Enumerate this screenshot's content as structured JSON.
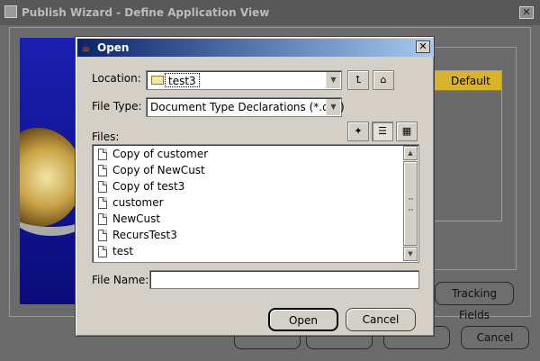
{
  "outer_window": {
    "title": "Publish Wizard - Define Application View",
    "close_glyph": "✕",
    "table_header": "Default",
    "tracking_fields_label": "Tracking Fields",
    "cancel_label": "Cancel"
  },
  "dialog": {
    "title": "Open",
    "close_glyph": "✕",
    "location_label": "Location:",
    "location_value": "test3",
    "file_type_label": "File Type:",
    "file_type_value": "Document Type Declarations (*.dtd)",
    "files_label": "Files:",
    "file_name_label": "File Name:",
    "file_name_value": "",
    "files": [
      "Copy of customer",
      "Copy of NewCust",
      "Copy of test3",
      "customer",
      "NewCust",
      "RecursTest3",
      "test"
    ],
    "open_label": "Open",
    "cancel_label": "Cancel"
  },
  "icons": {
    "java": "java-cup-icon",
    "folder": "folder-icon",
    "up_folder": "up-one-level-icon",
    "home": "home-folder-icon",
    "new_folder": "new-folder-icon",
    "list_view": "list-view-icon",
    "details_view": "details-view-icon",
    "file": "document-icon"
  },
  "colors": {
    "dialog_title_start": "#0a246a",
    "dialog_title_end": "#a6caf0",
    "dialog_face": "#d4d0c8",
    "table_header": "#d8b42c"
  }
}
